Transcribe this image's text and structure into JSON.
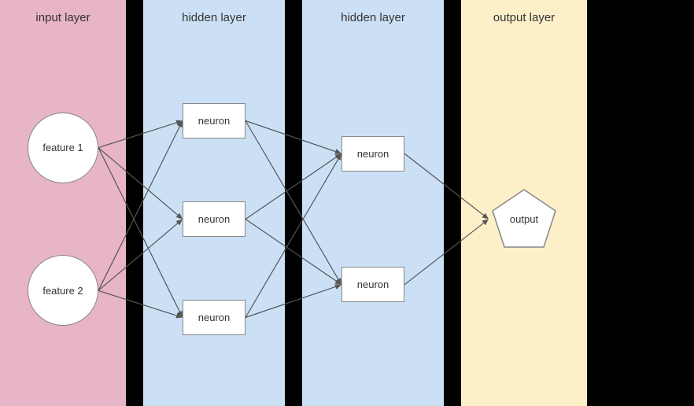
{
  "layers": [
    {
      "id": "input",
      "title": "input layer",
      "type": "input",
      "nodes": [
        {
          "label": "feature 1"
        },
        {
          "label": "feature 2"
        }
      ]
    },
    {
      "id": "hidden1",
      "title": "hidden layer",
      "type": "hidden",
      "nodes": [
        {
          "label": "neuron"
        },
        {
          "label": "neuron"
        },
        {
          "label": "neuron"
        }
      ]
    },
    {
      "id": "hidden2",
      "title": "hidden layer",
      "type": "hidden",
      "nodes": [
        {
          "label": "neuron"
        },
        {
          "label": "neuron"
        }
      ]
    },
    {
      "id": "output",
      "title": "output layer",
      "type": "output",
      "nodes": [
        {
          "label": "output"
        }
      ]
    }
  ]
}
